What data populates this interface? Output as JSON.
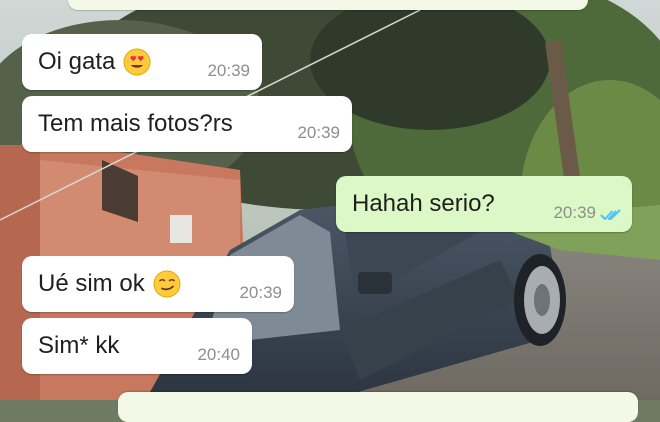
{
  "chat": {
    "messages": [
      {
        "text": "Oi gata",
        "time": "20:39",
        "direction": "incoming",
        "emoji": "heart-eyes-face-icon"
      },
      {
        "text": "Tem mais fotos?rs",
        "time": "20:39",
        "direction": "incoming"
      },
      {
        "text": "Hahah serio?",
        "time": "20:39",
        "direction": "outgoing",
        "status": "read-double-check-icon"
      },
      {
        "text": "Ué sim ok",
        "time": "20:39",
        "direction": "incoming",
        "emoji": "smirking-face-icon"
      },
      {
        "text": "Sim* kk",
        "time": "20:40",
        "direction": "incoming"
      }
    ]
  },
  "colors": {
    "incoming_bubble": "#ffffff",
    "outgoing_bubble": "#dcf8c6",
    "read_ticks": "#4fc3f7",
    "timestamp": "#8e8e8e"
  }
}
